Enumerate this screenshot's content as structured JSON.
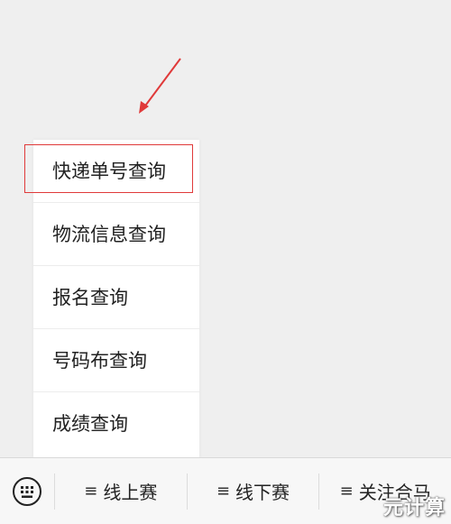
{
  "popup_menu": {
    "items": [
      {
        "label": "快递单号查询"
      },
      {
        "label": "物流信息查询"
      },
      {
        "label": "报名查询"
      },
      {
        "label": "号码布查询"
      },
      {
        "label": "成绩查询"
      }
    ]
  },
  "bottom_bar": {
    "menus": [
      {
        "label": "线上赛"
      },
      {
        "label": "线下赛"
      },
      {
        "label": "关注合马"
      }
    ],
    "menu_glyph": "≡"
  },
  "watermark": {
    "text": "元计算"
  },
  "colors": {
    "annotation": "#e03a3a",
    "background": "#efefef",
    "menu_bg": "#ffffff"
  },
  "icons": {
    "keyboard": "keyboard-icon",
    "arrow": "annotation-arrow-icon"
  }
}
